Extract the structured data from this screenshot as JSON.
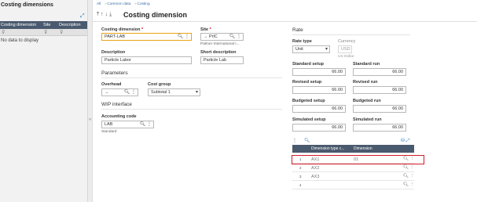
{
  "left_panel": {
    "title": "Costing dimensions",
    "columns": [
      "Costing dimension",
      "Site",
      "Description"
    ],
    "empty_text": "No data to display"
  },
  "breadcrumb": [
    "All",
    "Common data",
    "Costing"
  ],
  "page_title": "Costing dimension",
  "form": {
    "costing_dimension_label": "Costing dimension",
    "costing_dimension_value": "PART-LAB",
    "site_label": "Site",
    "site_value": "PrlC",
    "site_sub": "Palmer International I...",
    "description_label": "Description",
    "description_value": "Particle Labor",
    "short_description_label": "Short description",
    "short_description_value": "Particle Lab",
    "parameters_section": "Parameters",
    "overhead_label": "Overhead",
    "overhead_value": "",
    "cost_group_label": "Cost group",
    "cost_group_value": "Subtotal 1",
    "wip_section": "WIP interface",
    "accounting_code_label": "Accounting code",
    "accounting_code_value": "LAB",
    "accounting_code_sub": "Standard"
  },
  "rate": {
    "section": "Rate",
    "rate_type_label": "Rate type",
    "rate_type_value": "Unit",
    "currency_label": "Currency",
    "currency_value": "USD",
    "currency_sub": "US Dollar",
    "standard_setup_label": "Standard setup",
    "standard_setup_value": "66.00",
    "standard_run_label": "Standard run",
    "standard_run_value": "66.00",
    "revised_setup_label": "Revised setup",
    "revised_setup_value": "66.00",
    "revised_run_label": "Revised run",
    "revised_run_value": "66.00",
    "budgeted_setup_label": "Budgeted setup",
    "budgeted_setup_value": "66.00",
    "budgeted_run_label": "Budgeted run",
    "budgeted_run_value": "66.00",
    "simulated_setup_label": "Simulated setup",
    "simulated_setup_value": "66.00",
    "simulated_run_label": "Simulated run",
    "simulated_run_value": "66.00"
  },
  "grid": {
    "columns": [
      "Dimension type c...",
      "Dimension"
    ],
    "rows": [
      {
        "num": "1",
        "type": "AX1",
        "dimension": "01"
      },
      {
        "num": "2",
        "type": "AX2",
        "dimension": ""
      },
      {
        "num": "3",
        "type": "AX3",
        "dimension": ""
      },
      {
        "num": "4",
        "type": "",
        "dimension": ""
      }
    ]
  },
  "colors": {
    "header_bg": "#4a5a6e",
    "link_blue": "#2b79c2",
    "focus_border": "#e8a317",
    "highlight_red": "#d01c2a"
  }
}
